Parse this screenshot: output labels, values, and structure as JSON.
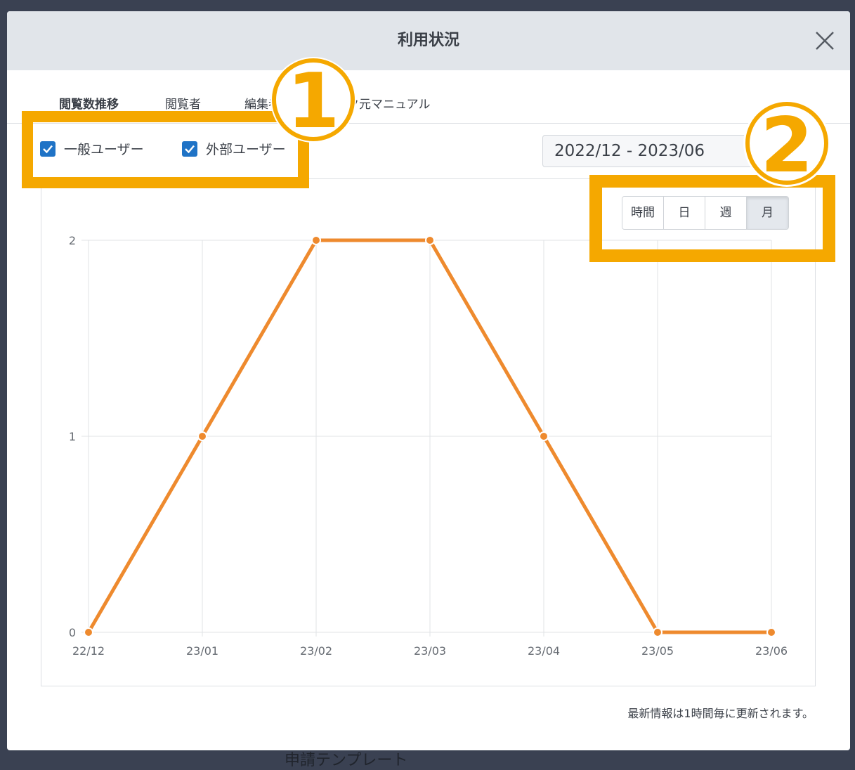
{
  "background": {
    "partial_text": "申請テンプレート"
  },
  "modal": {
    "title": "利用状況",
    "close_icon": "close-icon"
  },
  "tabs": [
    {
      "label": "閲覧数推移",
      "active": true
    },
    {
      "label": "閲覧者",
      "active": false
    },
    {
      "label": "編集者",
      "active": false
    },
    {
      "label": "リンク元マニュアル",
      "active": false
    }
  ],
  "filters": {
    "general_users": {
      "label": "一般ユーザー",
      "checked": true
    },
    "external_users": {
      "label": "外部ユーザー",
      "checked": true
    }
  },
  "date_range": {
    "value": "2022/12 - 2023/06",
    "icon": "chevron-down-icon"
  },
  "granularity": {
    "options": [
      "時間",
      "日",
      "週",
      "月"
    ],
    "selected": "月"
  },
  "annotations": {
    "marker1": "1",
    "marker2": "2",
    "color": "#f5a800"
  },
  "chart_data": {
    "type": "line",
    "categories": [
      "22/12",
      "23/01",
      "23/02",
      "23/03",
      "23/04",
      "23/05",
      "23/06"
    ],
    "values": [
      0,
      1,
      2,
      2,
      1,
      0,
      0
    ],
    "yticks": [
      "0",
      "1",
      "2"
    ],
    "ylim": [
      0,
      2
    ],
    "grid": true,
    "line_color": "#ee8a2e"
  },
  "footer": {
    "note": "最新情報は1時間毎に更新されます。"
  }
}
